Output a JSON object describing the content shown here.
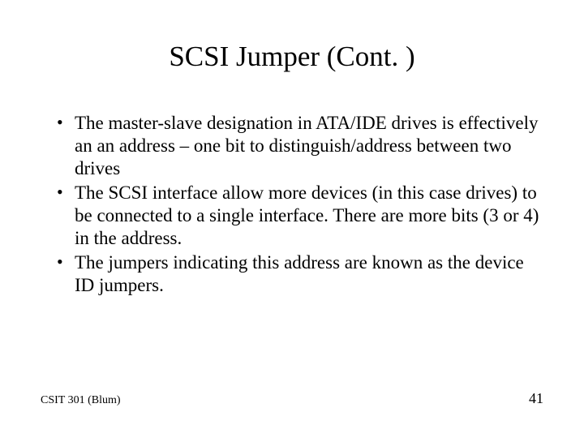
{
  "title": "SCSI Jumper (Cont. )",
  "bullets": [
    "The master-slave designation in ATA/IDE drives is effectively an an address – one bit to distinguish/address between two drives",
    "The SCSI interface allow more devices (in this case drives) to be connected to a single interface. There are more bits (3 or 4) in the address.",
    "The jumpers indicating this address are known as the device ID jumpers."
  ],
  "footer": {
    "left": "CSIT 301 (Blum)",
    "right": "41"
  }
}
